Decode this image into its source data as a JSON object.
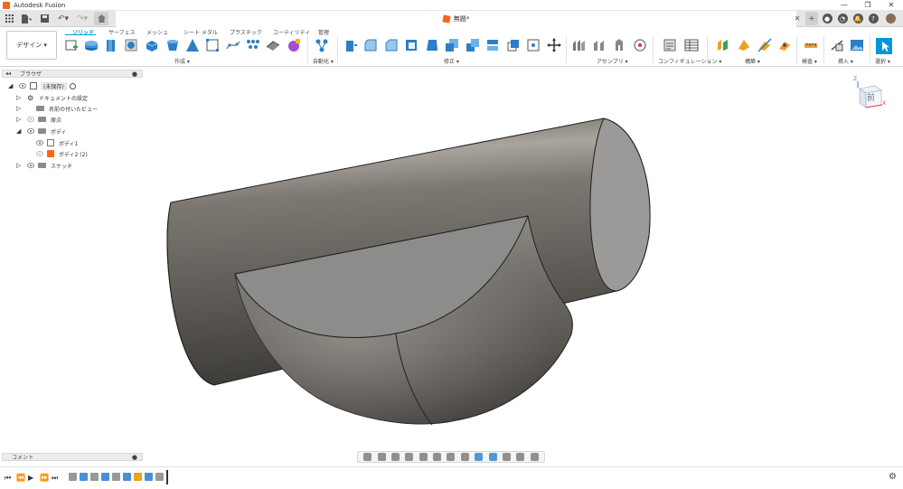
{
  "app": {
    "title": "Autodesk Fusion"
  },
  "window": {
    "minimize": "—",
    "maximize": "❐",
    "close": "✕"
  },
  "document": {
    "title": "無題*"
  },
  "appbar": {
    "add_tab": "+",
    "help": "?",
    "close_tab": "✕"
  },
  "ribbon": {
    "workspace": "デザイン ▾",
    "tabs": [
      "ソリッド",
      "サーフェス",
      "メッシュ",
      "シート メタル",
      "プラスチック",
      "ユーティリティ",
      "管理"
    ],
    "groups": [
      "作成 ▾",
      "自動化 ▾",
      "修正 ▾",
      "アセンブリ ▾",
      "コンフィギュレーション ▾",
      "構築 ▾",
      "検査 ▾",
      "挿入 ▾",
      "選択 ▾"
    ]
  },
  "browser": {
    "title": "ブラウザ",
    "root": "(未保存)",
    "items": [
      "ドキュメントの設定",
      "名前の付いたビュー",
      "原点",
      "ボディ",
      "ボディ1",
      "ボディ2 (2)",
      "スケッチ"
    ]
  },
  "comments": {
    "title": "コメント"
  },
  "viewcube": {
    "face": "前",
    "z": "Z",
    "x": "X"
  },
  "colors": {
    "accent": "#0696d7",
    "body": "#6f6b66",
    "cap": "#9a9a99"
  }
}
